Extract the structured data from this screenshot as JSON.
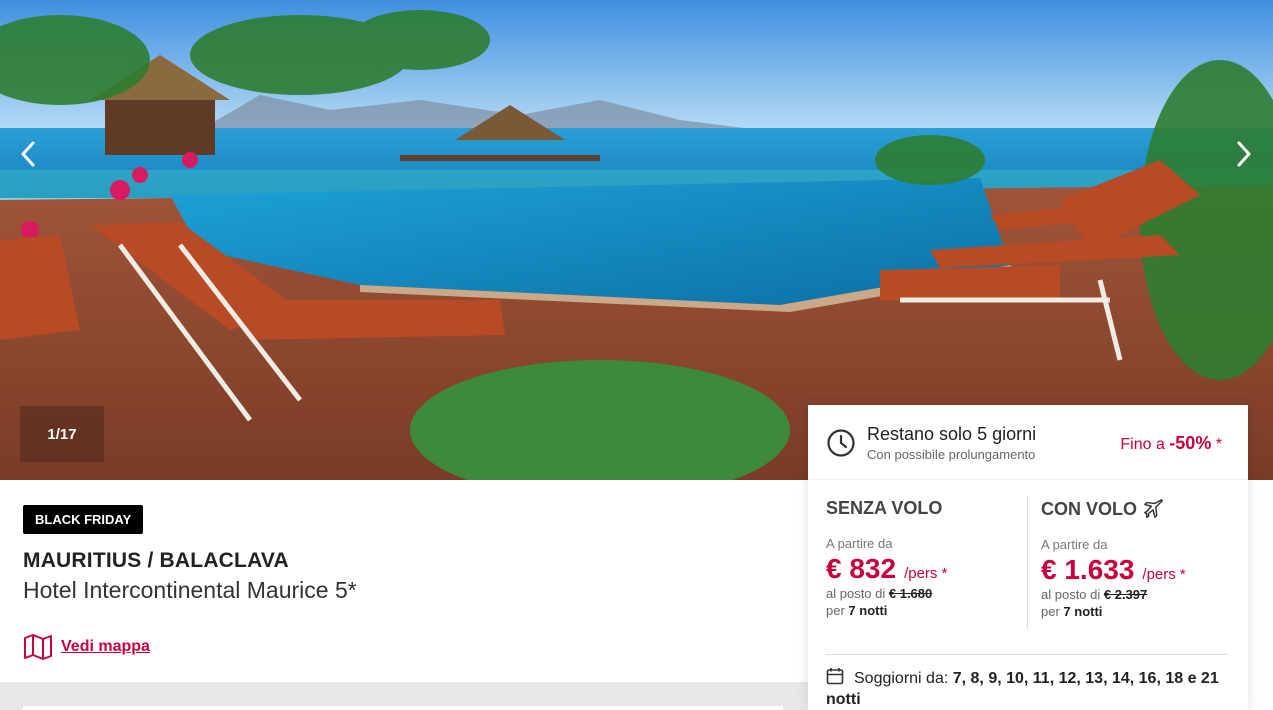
{
  "gallery": {
    "counter": "1/17",
    "prev_icon": "chevron-left-icon",
    "next_icon": "chevron-right-icon"
  },
  "offer": {
    "badge": "BLACK FRIDAY",
    "destination": "MAURITIUS / BALACLAVA",
    "hotel": "Hotel Intercontinental Maurice 5*",
    "map_link": "Vedi mappa"
  },
  "urgency": {
    "title": "Restano solo 5 giorni",
    "subtitle": "Con possibile prolungamento",
    "discount_prefix": "Fino a ",
    "discount_value": "-50%",
    "discount_suffix": " *"
  },
  "pricing": {
    "without_flight": {
      "heading": "SENZA VOLO",
      "from_label": "A partire da",
      "price": "€ 832",
      "per": "/pers *",
      "instead_label": "al posto di ",
      "instead_price": "€ 1.680",
      "nights_label": "per ",
      "nights": "7 notti"
    },
    "with_flight": {
      "heading": "CON VOLO",
      "from_label": "A partire da",
      "price": "€ 1.633",
      "per": "/pers *",
      "instead_label": "al posto di ",
      "instead_price": "€ 2.397",
      "nights_label": "per ",
      "nights": "7 notti"
    }
  },
  "stays": {
    "label": "Soggiorni da: ",
    "values": "7, 8, 9, 10, 11, 12, 13, 14, 16, 18 e 21 notti"
  },
  "colors": {
    "accent": "#c8003c",
    "badge_bg": "#000000"
  }
}
